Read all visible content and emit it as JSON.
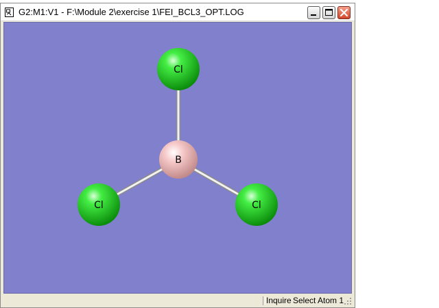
{
  "window": {
    "title": "G2:M1:V1 - F:\\Module 2\\exercise 1\\FEI_BCL3_OPT.LOG"
  },
  "icons": {
    "app": "document-app-icon",
    "minimize": "minimize-icon",
    "maximize": "maximize-icon",
    "close": "close-icon",
    "grip": "size-grip-icon"
  },
  "molecule": {
    "center": {
      "label": "B",
      "color": "#f0b8b8"
    },
    "ligands": [
      {
        "label": "Cl",
        "color": "#22dd22"
      },
      {
        "label": "Cl",
        "color": "#22dd22"
      },
      {
        "label": "Cl",
        "color": "#22dd22"
      }
    ],
    "background_color": "#8080cc",
    "bond_color": "#e8e8e8"
  },
  "statusbar": {
    "mode": "Inquire",
    "message": "Select Atom 1"
  }
}
